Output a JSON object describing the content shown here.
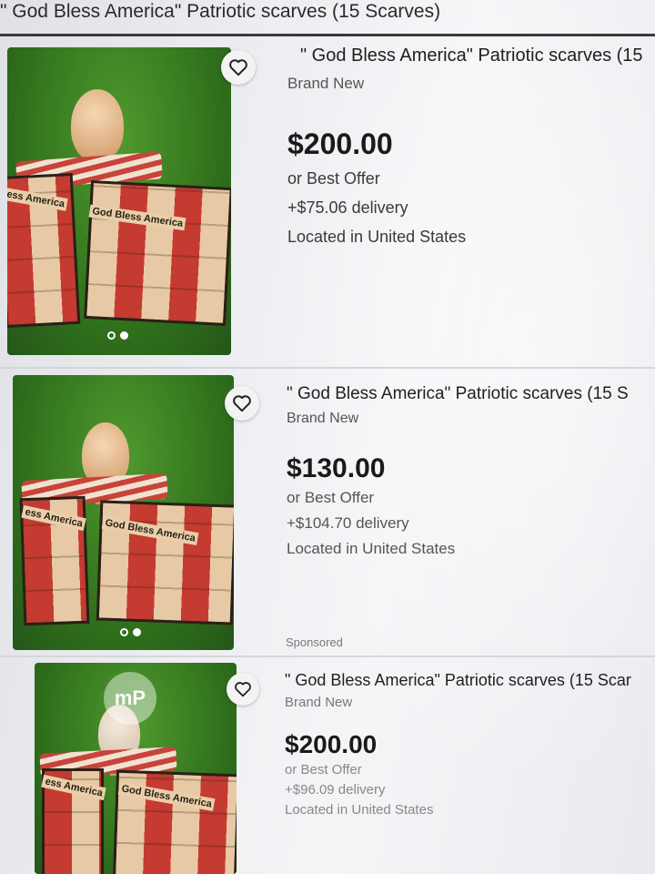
{
  "previous_listing": {
    "title": "\" God Bless America\" Patriotic scarves (15 Scarves)"
  },
  "listings": [
    {
      "title": "\" God Bless America\" Patriotic scarves (15",
      "condition": "Brand New",
      "price": "$200.00",
      "offer": "or Best Offer",
      "delivery": "+$75.06 delivery",
      "location": "Located in United States",
      "image_labels": [
        "ess America",
        "God Bless America"
      ],
      "image_index": {
        "current": 1,
        "total": 2
      },
      "icons": {
        "watchlist": "heart-icon"
      }
    },
    {
      "title": "\" God Bless America\" Patriotic scarves (15 S",
      "condition": "Brand New",
      "price": "$130.00",
      "offer": "or Best Offer",
      "delivery": "+$104.70 delivery",
      "location": "Located in United States",
      "image_labels": [
        "ess America",
        "God Bless America"
      ],
      "image_index": {
        "current": 1,
        "total": 2
      },
      "icons": {
        "watchlist": "heart-icon"
      }
    },
    {
      "badge": "Sponsored",
      "title": "\" God Bless America\" Patriotic scarves (15 Scar",
      "condition": "Brand New",
      "price": "$200.00",
      "offer": "or Best Offer",
      "delivery": "+$96.09 delivery",
      "location": "Located in United States",
      "image_labels": [
        "ess America",
        "God Bless America"
      ],
      "watermark": "mP",
      "icons": {
        "watchlist": "heart-icon"
      }
    }
  ],
  "colors": {
    "accent_text": "#1a1a1a",
    "background": "#eceef1",
    "photo_green": "#2f6e1b"
  }
}
